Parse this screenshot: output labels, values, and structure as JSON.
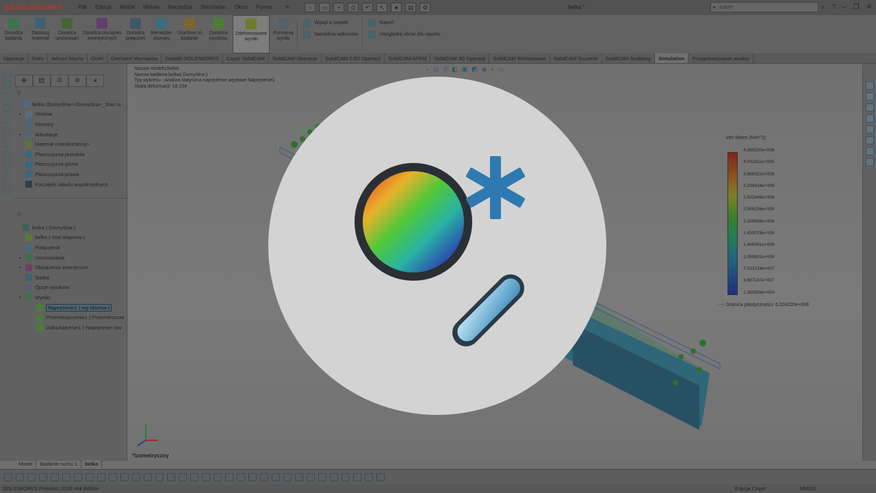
{
  "app": {
    "brand": "SOLIDWORKS",
    "brand_prefix": "3S",
    "document_title": "belka *",
    "search_placeholder": "solver",
    "edition": "SOLIDWORKS Premium 2016 x64 Edition"
  },
  "menu": [
    "Plik",
    "Edycja",
    "Widok",
    "Wstaw",
    "Narzędzia",
    "Simulation",
    "Okno",
    "Pomoc"
  ],
  "command_manager": {
    "buttons": [
      {
        "label": "Doradca badania",
        "color": "#3e7f52"
      },
      {
        "label": "Zastosuj materiał",
        "color": "#3f6a80"
      },
      {
        "label": "Doradca umocowań",
        "color": "#4b6e3a"
      },
      {
        "label": "Doradca obciążeń zewnętrznych",
        "color": "#6b3f7a"
      },
      {
        "label": "Doradca połączeń",
        "color": "#3f5d6e"
      },
      {
        "label": "Menedżer skorupy",
        "color": "#3b7a8e"
      },
      {
        "label": "Uruchom to badanie",
        "color": "#8a6e2e"
      },
      {
        "label": "Doradca wyników",
        "color": "#4f8a3a"
      },
      {
        "label": "Zdeformowane wyniki",
        "color": "#7a8a2a"
      },
      {
        "label": "Porównaj wyniki",
        "color": "#5d6a74"
      }
    ],
    "group1": [
      "Wgląd w projekt",
      "Narzędzia wykresów"
    ],
    "group2": [
      "Raport",
      "Uwzględnij obraz dla raportu"
    ]
  },
  "tabs": [
    "Operacje",
    "Szkic",
    "Arkusz blachy",
    "Oceń",
    "DimXpert Wymiarów",
    "Dodatki SOLIDWORKS",
    "Część SolidCAM",
    "SolidCAM Operacje",
    "SolidCAM 2.5D Operacji",
    "SolidCAM AFRM",
    "SolidCAM 3D Operacji",
    "SolidCAM Wieloosiowe",
    "SolidCAM Toczenie",
    "SolidCAM Szablony",
    "Simulation",
    "Przygotowywanie analizy"
  ],
  "selected_tab": "Simulation",
  "feature_tree": {
    "root": "belka  (Domyślna<<Domyślna>_Stan w",
    "items": [
      "Historia",
      "Sensory",
      "Adnotacje",
      "Materiał <nieokreślony>",
      "Płaszczyzna przednia",
      "Płaszczyzna górna",
      "Płaszczyzna prawa",
      "Początek układu współrzędnych"
    ]
  },
  "study_tree": {
    "root": "belka (-Domyślna-)",
    "items": [
      "belka (-Stal stopowa-)",
      "Połączenia",
      "Umocowania",
      "Obciążenia zewnętrzne",
      "Siatka",
      "Opcje wyników",
      "Wyniki"
    ],
    "results": [
      "Naprężenie1 (-wg Misesa-)",
      "Przemieszczenie1 (-Przemieszcze",
      "Odkształcenie1 (-Naprężenie rów"
    ]
  },
  "viewport_info": {
    "line1": "Nazwa modelu:belka",
    "line2": "Nazwa badania:belka(-Domyślna-)",
    "line3": "Typ wykresu : Analiza statyczna naprężenie węzłowe Naprężenie1",
    "line4": "Skala deformacji: 18.154",
    "view_name": "*Izometryczny"
  },
  "legend": {
    "title": "von Mises (N/m^2)",
    "ticks": [
      "4.399200e+008",
      "4.032611e+008",
      "3.666022e+008",
      "3.299434e+008",
      "2.932845e+008",
      "2.566256e+008",
      "2.199668e+008",
      "1.833079e+008",
      "1.466491e+008",
      "1.099902e+008",
      "7.333134e+007",
      "3.667247e+007",
      "1.360593e+004"
    ],
    "yield": "Granica plastyczności: 6.204220e+008",
    "max": 439920000,
    "min": 13605.93
  },
  "bottom_tabs": [
    "Model",
    "Badanie ruchu 1",
    "belka"
  ],
  "status": {
    "editing": "Edycja Część",
    "units": "MMGS"
  },
  "overlay": {
    "icon": "simulation-results-icon",
    "accent": "#2e7ab0"
  }
}
